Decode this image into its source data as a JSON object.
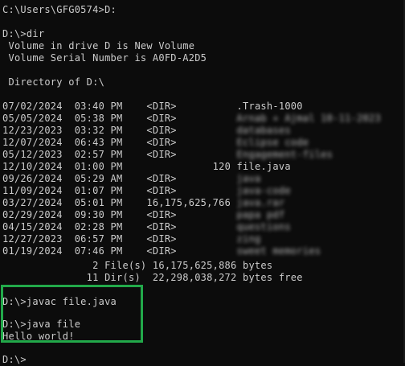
{
  "console": {
    "cd_command": "C:\\Users\\GFG0574>D:",
    "dir_prompt": "D:\\>dir",
    "volume_line": " Volume in drive D is New Volume",
    "serial_line": " Volume Serial Number is A0FD-A2D5",
    "directory_line": " Directory of D:\\",
    "entries": [
      {
        "date": "07/02/2024",
        "time": "03:40 PM",
        "type": "<DIR>",
        "size": "",
        "name": ".Trash-1000",
        "blurred": false
      },
      {
        "date": "05/05/2024",
        "time": "05:38 PM",
        "type": "<DIR>",
        "size": "",
        "name": "Arnab + Ajmal 10-11-2023",
        "blurred": true
      },
      {
        "date": "12/23/2023",
        "time": "03:32 PM",
        "type": "<DIR>",
        "size": "",
        "name": "databases",
        "blurred": true
      },
      {
        "date": "12/07/2024",
        "time": "06:43 PM",
        "type": "<DIR>",
        "size": "",
        "name": "Eclipse code",
        "blurred": true
      },
      {
        "date": "05/12/2023",
        "time": "02:57 PM",
        "type": "<DIR>",
        "size": "",
        "name": "Engagement-files",
        "blurred": true
      },
      {
        "date": "12/10/2024",
        "time": "01:00 PM",
        "type": "",
        "size": "120",
        "name": "file.java",
        "blurred": false
      },
      {
        "date": "09/26/2024",
        "time": "05:29 AM",
        "type": "<DIR>",
        "size": "",
        "name": "java",
        "blurred": true
      },
      {
        "date": "11/09/2024",
        "time": "01:07 PM",
        "type": "<DIR>",
        "size": "",
        "name": "java-code",
        "blurred": true
      },
      {
        "date": "03/27/2024",
        "time": "05:01 PM",
        "type": "",
        "size": "16,175,625,766",
        "name": "java.rar",
        "blurred": true
      },
      {
        "date": "02/29/2024",
        "time": "09:30 PM",
        "type": "<DIR>",
        "size": "",
        "name": "papa pdf",
        "blurred": true
      },
      {
        "date": "04/15/2024",
        "time": "02:28 PM",
        "type": "<DIR>",
        "size": "",
        "name": "questions",
        "blurred": true
      },
      {
        "date": "12/27/2023",
        "time": "06:57 PM",
        "type": "<DIR>",
        "size": "",
        "name": "zing",
        "blurred": true
      },
      {
        "date": "01/19/2024",
        "time": "07:46 PM",
        "type": "<DIR>",
        "size": "",
        "name": "sweet memories",
        "blurred": true
      }
    ],
    "files_summary": "               2 File(s) 16,175,625,886 bytes",
    "dirs_summary": "              11 Dir(s)  22,298,038,272 bytes free",
    "javac_command": "D:\\>javac file.java",
    "java_command": "D:\\>java file",
    "program_output": "Hello world!",
    "final_prompt": "D:\\>"
  },
  "colors": {
    "background": "#0c0c0c",
    "text": "#cccccc",
    "highlight_border": "#22a94a"
  }
}
